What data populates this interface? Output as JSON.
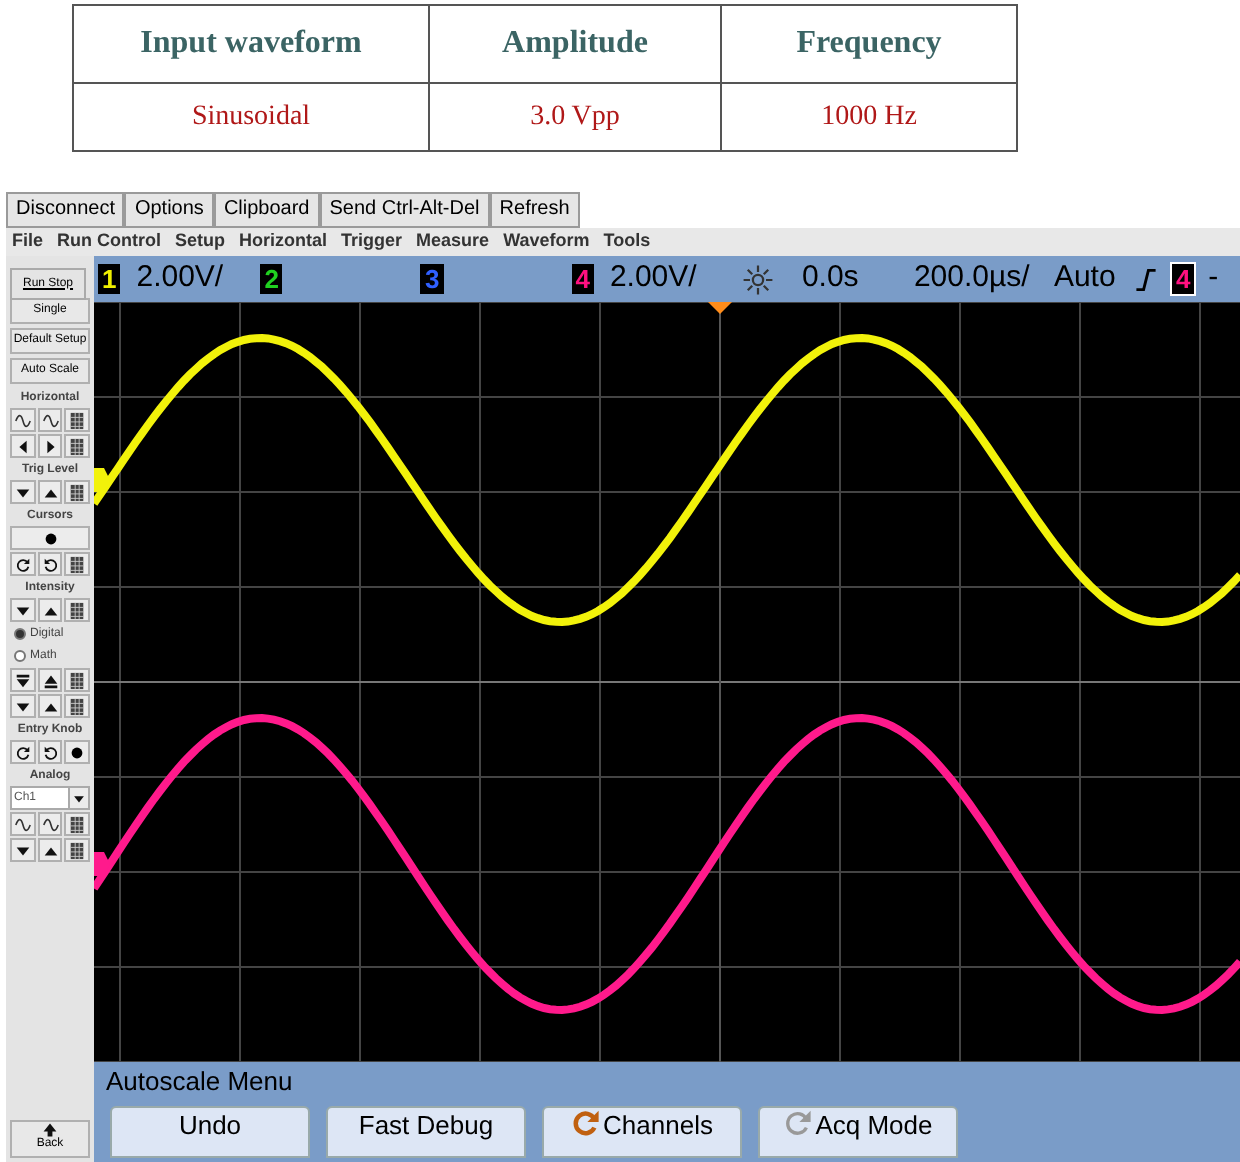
{
  "table": {
    "columns": [
      "Input waveform",
      "Amplitude",
      "Frequency"
    ],
    "rows": [
      [
        "Sinusoidal",
        "3.0 Vpp",
        "1000 Hz"
      ]
    ]
  },
  "toolbar": [
    "Disconnect",
    "Options",
    "Clipboard",
    "Send Ctrl-Alt-Del",
    "Refresh"
  ],
  "menu": [
    "File",
    "Run Control",
    "Setup",
    "Horizontal",
    "Trigger",
    "Measure",
    "Waveform",
    "Tools"
  ],
  "status_bar": {
    "run_stop": "Run Stop",
    "ch1": "1",
    "ch1_scale": "2.00V/",
    "ch2": "2",
    "ch3": "3",
    "ch4": "4",
    "ch4_scale": "2.00V/",
    "delay": "0.0s",
    "timebase": "200.0µs/",
    "trigger_mode": "Auto",
    "trigger_source": "4",
    "cut": "-"
  },
  "sidebar": [
    {
      "kind": "button",
      "label": "Single"
    },
    {
      "kind": "button",
      "label": "Default Setup"
    },
    {
      "kind": "button",
      "label": "Auto Scale"
    },
    {
      "kind": "label",
      "label": "Horizontal"
    },
    {
      "kind": "icons"
    },
    {
      "kind": "icons"
    },
    {
      "kind": "label",
      "label": "Trig Level"
    },
    {
      "kind": "icons"
    },
    {
      "kind": "label",
      "label": "Cursors"
    },
    {
      "kind": "icons"
    },
    {
      "kind": "icons"
    },
    {
      "kind": "label",
      "label": "Intensity"
    },
    {
      "kind": "icons"
    },
    {
      "kind": "radio",
      "label": "Digital",
      "selected": true
    },
    {
      "kind": "radio",
      "label": "Math",
      "selected": false
    },
    {
      "kind": "icons"
    },
    {
      "kind": "icons"
    },
    {
      "kind": "label",
      "label": "Entry Knob"
    },
    {
      "kind": "icons"
    },
    {
      "kind": "label",
      "label": "Analog"
    },
    {
      "kind": "dropdown",
      "label": "Ch1"
    },
    {
      "kind": "icons"
    },
    {
      "kind": "icons"
    }
  ],
  "back": "Back",
  "softkey_menu": {
    "title": "Autoscale Menu",
    "keys": [
      "Undo",
      "Fast Debug",
      "Channels",
      "Acq Mode"
    ]
  }
}
